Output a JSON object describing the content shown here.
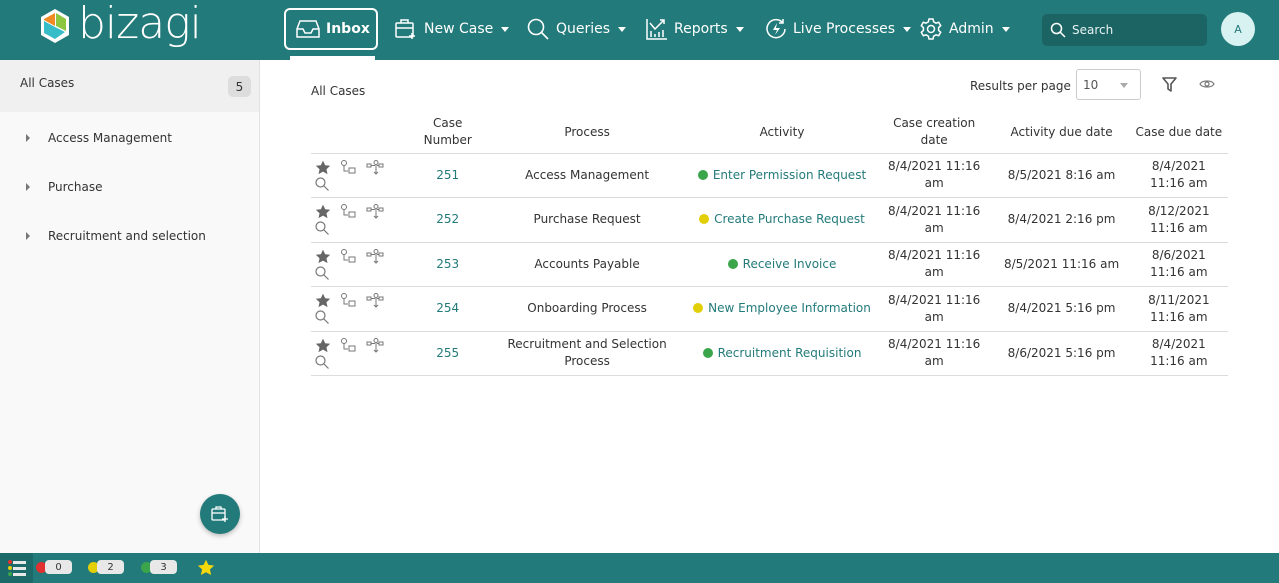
{
  "app": {
    "logo_text": "bizagi"
  },
  "nav": {
    "inbox": "Inbox",
    "new_case": "New Case",
    "queries": "Queries",
    "reports": "Reports",
    "live_processes": "Live Processes",
    "admin": "Admin",
    "search_placeholder": "Search",
    "avatar_initial": "A"
  },
  "sidebar": {
    "header_label": "All Cases",
    "header_count": "5",
    "items": [
      {
        "label": "Access Management"
      },
      {
        "label": "Purchase"
      },
      {
        "label": "Recruitment and selection"
      }
    ]
  },
  "main": {
    "title": "All Cases",
    "results_per_page_label": "Results per page",
    "results_per_page_value": "10",
    "columns": {
      "case_number": "Case Number",
      "process": "Process",
      "activity": "Activity",
      "case_creation_date": "Case creation date",
      "activity_due_date": "Activity due date",
      "case_due_date": "Case due date"
    },
    "rows": [
      {
        "case_number": "251",
        "process": "Access Management",
        "activity": "Enter Permission Request",
        "status_color": "#3aa54a",
        "created": "8/4/2021 11:16 am",
        "activity_due": "8/5/2021 8:16 am",
        "case_due": "8/4/2021 11:16 am"
      },
      {
        "case_number": "252",
        "process": "Purchase Request",
        "activity": "Create Purchase Request",
        "status_color": "#e2cf08",
        "created": "8/4/2021 11:16 am",
        "activity_due": "8/4/2021 2:16 pm",
        "case_due": "8/12/2021 11:16 am"
      },
      {
        "case_number": "253",
        "process": "Accounts Payable",
        "activity": "Receive Invoice",
        "status_color": "#3aa54a",
        "created": "8/4/2021 11:16 am",
        "activity_due": "8/5/2021 11:16 am",
        "case_due": "8/6/2021 11:16 am"
      },
      {
        "case_number": "254",
        "process": "Onboarding Process",
        "activity": "New Employee Information",
        "status_color": "#e2cf08",
        "created": "8/4/2021 11:16 am",
        "activity_due": "8/4/2021 5:16 pm",
        "case_due": "8/11/2021 11:16 am"
      },
      {
        "case_number": "255",
        "process": "Recruitment and Selection Process",
        "activity": "Recruitment Requisition",
        "status_color": "#3aa54a",
        "created": "8/4/2021 11:16 am",
        "activity_due": "8/6/2021 5:16 pm",
        "case_due": "8/4/2021 11:16 am"
      }
    ]
  },
  "footer": {
    "counters": [
      {
        "name": "overdue",
        "color": "#e03030",
        "value": "0"
      },
      {
        "name": "at-risk",
        "color": "#e2cf08",
        "value": "2"
      },
      {
        "name": "on-time",
        "color": "#3aa54a",
        "value": "3"
      }
    ]
  },
  "colors": {
    "brand": "#237a7a",
    "link": "#237a7a",
    "green": "#3aa54a",
    "yellow": "#e2cf08",
    "red": "#e03030"
  }
}
